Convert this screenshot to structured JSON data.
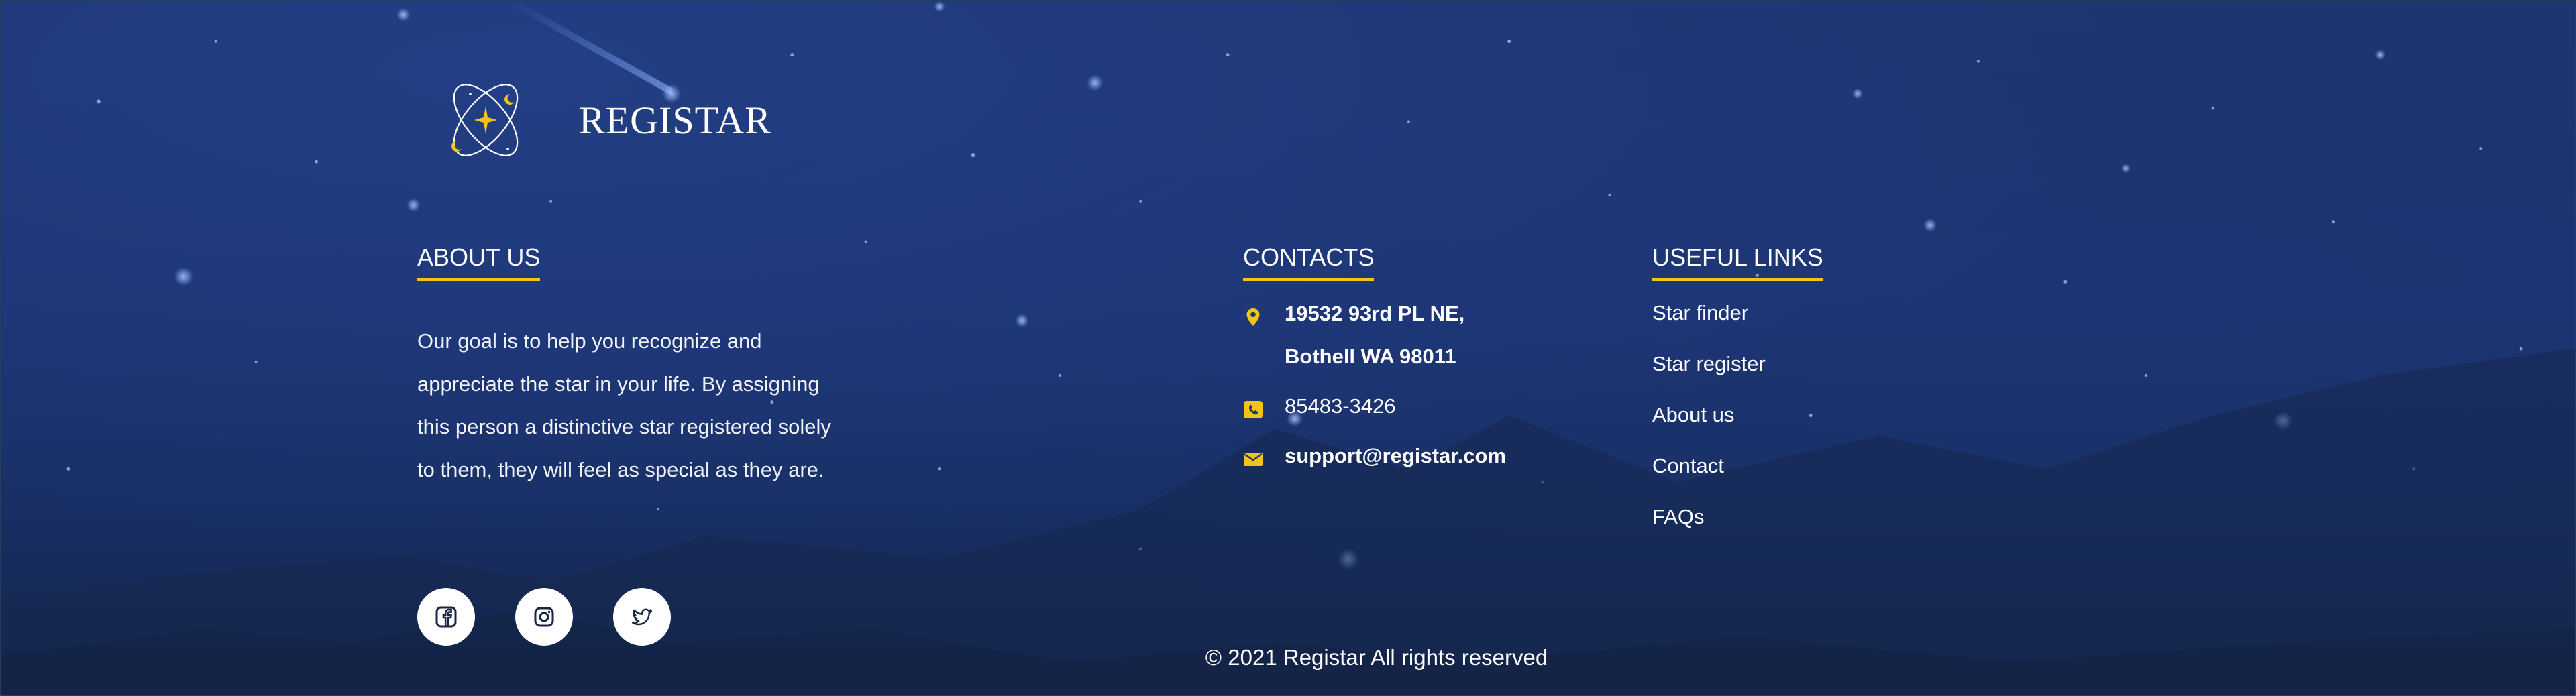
{
  "brand": {
    "name": "REGISTAR",
    "logo_icon": "orbit-star-logo"
  },
  "about": {
    "title": "ABOUT US",
    "text": "Our goal is to help you recognize and appreciate the star in your life. By assigning this person a distinctive star registered solely to them, they will feel as special as they are."
  },
  "social": [
    {
      "name": "facebook",
      "icon": "facebook-icon"
    },
    {
      "name": "instagram",
      "icon": "instagram-icon"
    },
    {
      "name": "twitter",
      "icon": "twitter-icon"
    }
  ],
  "contacts": {
    "title": "CONTACTS",
    "address_line1": "19532 93rd PL NE,",
    "address_line2": "Bothell WA 98011",
    "phone": "85483-3426",
    "email": "support@registar.com"
  },
  "useful_links": {
    "title": "USEFUL LINKS",
    "items": [
      "Star finder",
      "Star register",
      "About us",
      "Contact",
      "FAQs"
    ]
  },
  "copyright": "© 2021 Registar All rights reserved",
  "colors": {
    "accent": "#f2c418",
    "background": "#1b3370",
    "text": "#ffffff"
  }
}
